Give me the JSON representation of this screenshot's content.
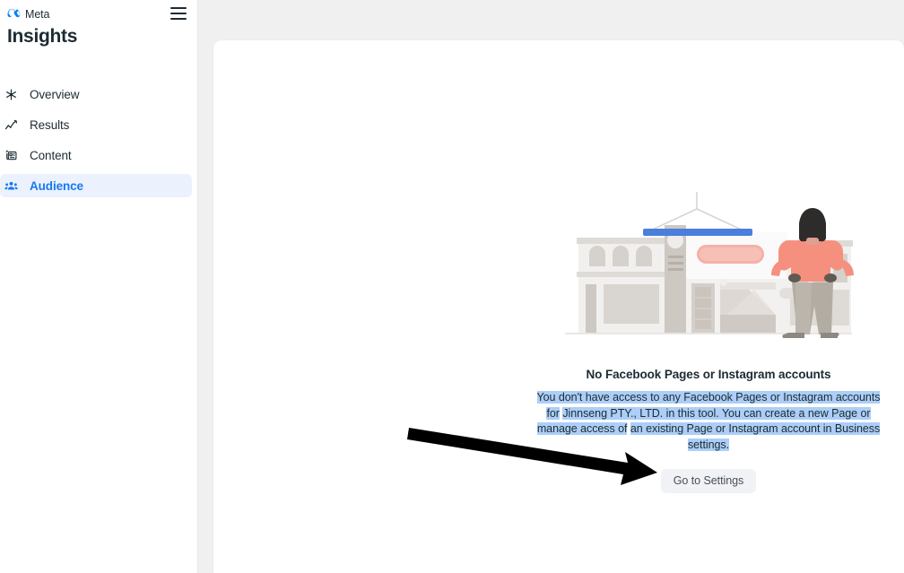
{
  "brand": {
    "logo_icon": "meta-infinity-logo",
    "name": "Meta",
    "menu_icon": "hamburger-menu-icon"
  },
  "sidebar": {
    "title": "Insights",
    "items": [
      {
        "label": "Overview",
        "icon": "overview-network-icon",
        "active": false
      },
      {
        "label": "Results",
        "icon": "results-trendline-icon",
        "active": false
      },
      {
        "label": "Content",
        "icon": "content-media-icon",
        "active": false
      },
      {
        "label": "Audience",
        "icon": "audience-people-icon",
        "active": true
      }
    ]
  },
  "main": {
    "empty_state": {
      "illustration_icon": "storefront-person-illustration",
      "heading": "No Facebook Pages or Instagram accounts",
      "body_line_1": "You don't have access to any Facebook Pages or Instagram accounts for",
      "body_line_2": "Jinnseng PTY., LTD. in this tool. You can create a new Page or manage access of",
      "body_line_3": "an existing Page or Instagram account in Business settings.",
      "button_label": "Go to Settings"
    }
  },
  "annotation": {
    "arrow_icon": "black-pointer-arrow",
    "points_to": "Go to Settings"
  },
  "colors": {
    "accent_blue": "#1877f2",
    "active_nav_background": "#ebf2fd",
    "text_selection": "#accef7",
    "canvas_background": "#f0f0f0",
    "card_background": "#ffffff",
    "button_background": "#f0f2f5",
    "annotation_arrow": "#000000"
  }
}
